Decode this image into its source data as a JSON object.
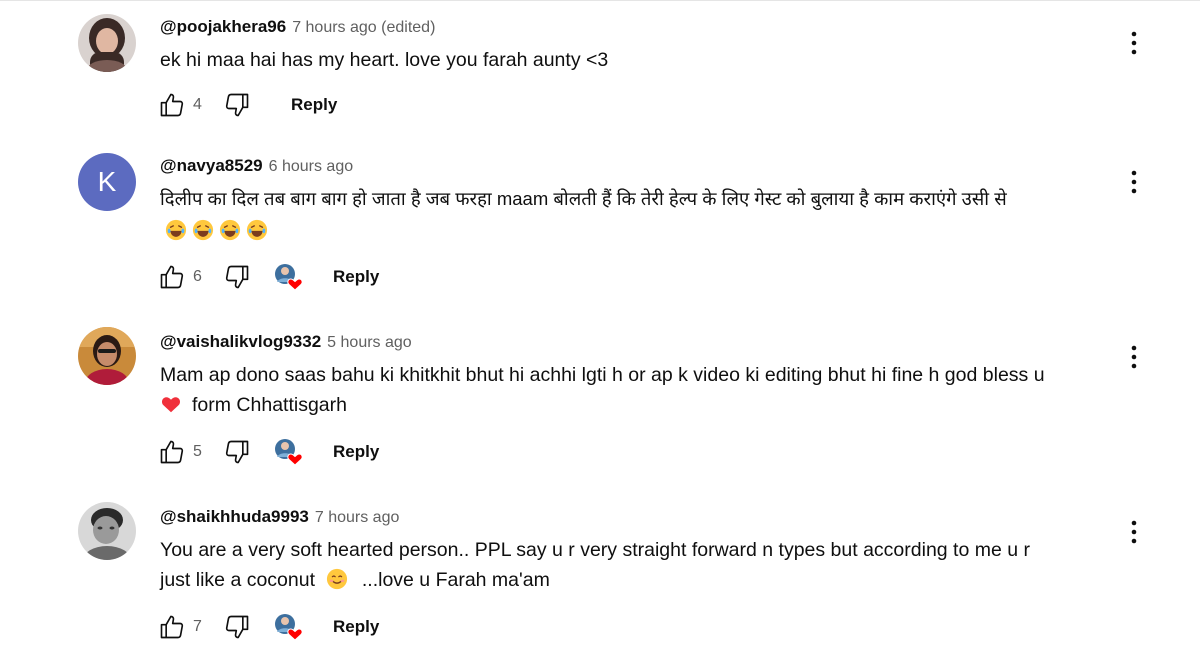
{
  "comments": [
    {
      "handle": "@poojakhera96",
      "time": "7 hours ago (edited)",
      "text": "ek hi maa hai has my heart. love you farah aunty <3",
      "likes": "4",
      "reply_label": "Reply",
      "avatar": "photo-avatar",
      "creator_heart": false
    },
    {
      "handle": "@navya8529",
      "time": "6 hours ago",
      "avatar_letter": "K",
      "text_line1": "दिलीप का दिल तब बाग बाग हो जाता है जब फरहा maam बोलती हैं कि तेरी हेल्प के लिए गेस्ट को बुलाया है काम कराएंगे उसी से",
      "emojis": "😂 😂 😂 😂",
      "likes": "6",
      "reply_label": "Reply",
      "creator_heart": true
    },
    {
      "handle": "@vaishalikvlog9332",
      "time": "5 hours ago",
      "text_line1": "Mam ap dono saas bahu ki khitkhit bhut hi achhi lgti h or ap k video ki editing bhut hi fine h god bless u",
      "text_line2": "form Chhattisgarh",
      "likes": "5",
      "reply_label": "Reply",
      "avatar": "photo-avatar",
      "creator_heart": true
    },
    {
      "handle": "@shaikhhuda9993",
      "time": "7 hours ago",
      "text_line1": "You are a very soft hearted person.. PPL say u r very straight forward n types but according to me u r",
      "text_line2a": "just like a coconut",
      "text_line2b": "...love u Farah ma'am",
      "likes": "7",
      "reply_label": "Reply",
      "avatar": "photo-avatar",
      "creator_heart": true
    }
  ],
  "icons": {
    "like": "thumbs-up-icon",
    "dislike": "thumbs-down-icon",
    "more": "vertical-dots-icon",
    "creator_heart": "creator-heart-icon"
  },
  "colors": {
    "secondary_text": "#606060",
    "avatar_k_bg": "#5c6bc0",
    "heart": "#ff0000"
  }
}
